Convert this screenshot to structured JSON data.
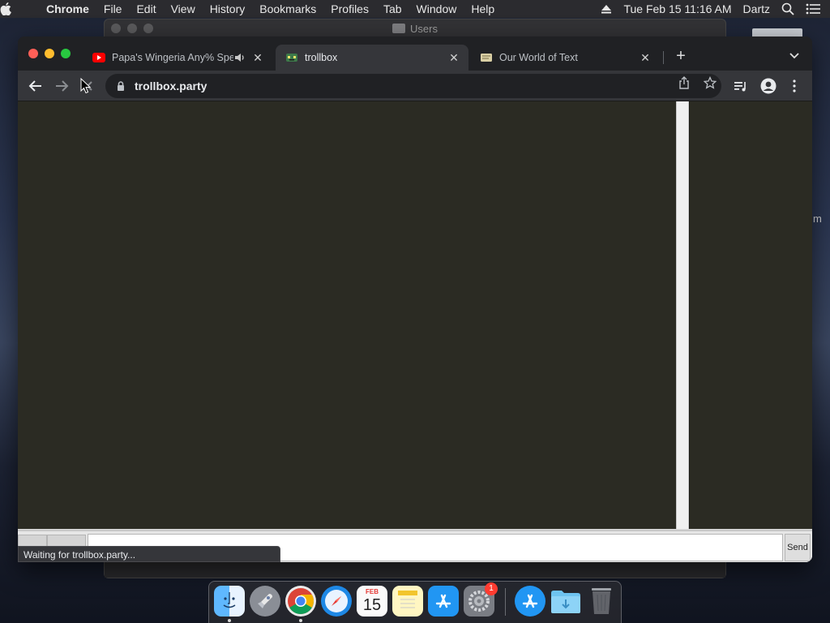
{
  "menubar": {
    "app": "Chrome",
    "items": [
      "File",
      "Edit",
      "View",
      "History",
      "Bookmarks",
      "Profiles",
      "Tab",
      "Window",
      "Help"
    ],
    "datetime": "Tue Feb 15  11:16 AM",
    "user": "Dartz"
  },
  "background_window": {
    "title": "Users"
  },
  "chrome": {
    "tabs": [
      {
        "title": "Papa's Wingeria Any% Spe",
        "favicon": "youtube-icon",
        "audio": true
      },
      {
        "title": "trollbox",
        "favicon": "trollbox-icon",
        "active": true
      },
      {
        "title": "Our World of Text",
        "favicon": "owot-icon"
      }
    ],
    "address": "trollbox.party",
    "status": "Waiting for trollbox.party..."
  },
  "page": {
    "send_label": "Send",
    "chat_bg": "#2b2b23"
  },
  "dock": {
    "calendar": {
      "month": "FEB",
      "day": "15"
    },
    "settings_badge": "1"
  }
}
